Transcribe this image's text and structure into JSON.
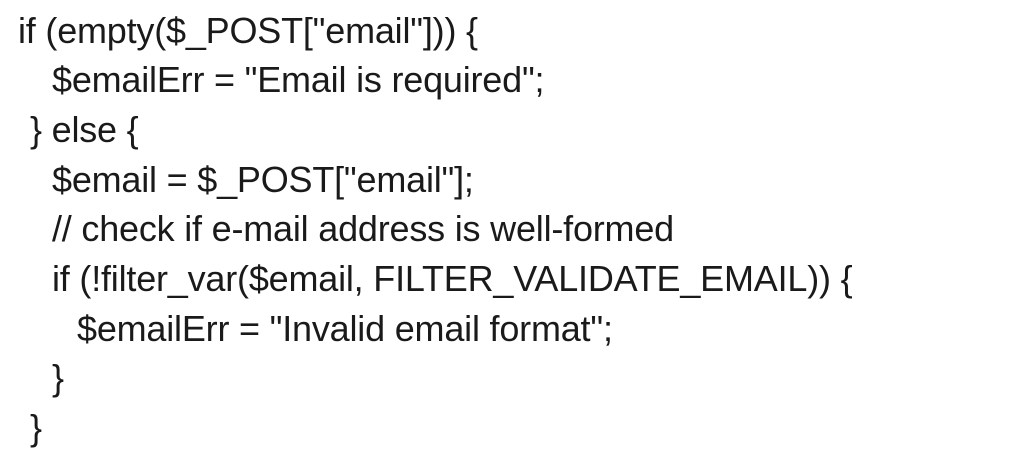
{
  "code": {
    "lines": [
      "if (empty($_POST[\"email\"])) {",
      "$emailErr = \"Email is required\";",
      "} else {",
      "$email = $_POST[\"email\"];",
      "// check if e-mail address is well-formed",
      "if (!filter_var($email, FILTER_VALIDATE_EMAIL)) {",
      "$emailErr = \"Invalid email format\";",
      "}",
      "}"
    ]
  }
}
